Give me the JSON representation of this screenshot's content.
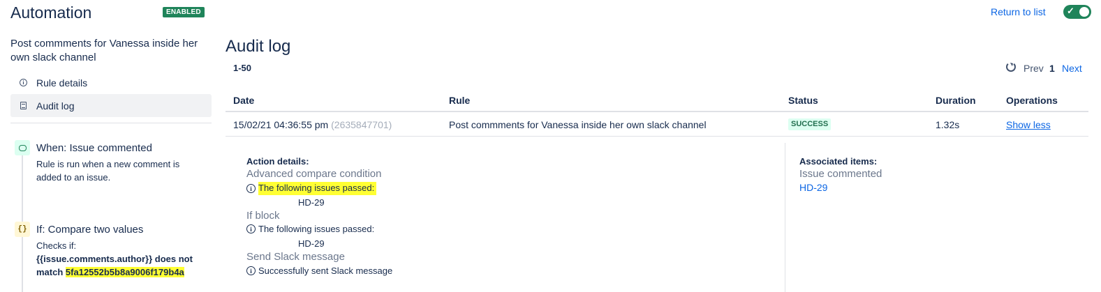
{
  "header": {
    "title": "Automation",
    "enabled_badge": "ENABLED",
    "return_link": "Return to list",
    "toggle_state": "on"
  },
  "sidebar": {
    "rule_name": "Post commments for Vanessa inside her own slack channel",
    "nav": [
      {
        "label": "Rule details",
        "icon": "info-icon"
      },
      {
        "label": "Audit log",
        "icon": "document-icon",
        "active": true
      }
    ],
    "components": [
      {
        "icon": "comment-icon",
        "title": "When: Issue commented",
        "description": "Rule is run when a new comment is added to an issue."
      },
      {
        "icon": "braces-icon",
        "icon_glyph": "{}",
        "title": "If: Compare two values",
        "checks_label": "Checks if:",
        "expression": "{{issue.comments.author}} does not match",
        "value": "5fa12552b5b8a9006f179b4a"
      }
    ]
  },
  "main": {
    "title": "Audit log",
    "range": "1-50",
    "pagination": {
      "prev": "Prev",
      "page": "1",
      "next": "Next"
    },
    "columns": [
      "Date",
      "Rule",
      "Status",
      "Duration",
      "Operations"
    ],
    "rows": [
      {
        "date": "15/02/21 04:36:55 pm",
        "execution_id": "(2635847701)",
        "rule": "Post commments for Vanessa inside her own slack channel",
        "status": "SUCCESS",
        "duration": "1.32s",
        "operation": "Show less"
      }
    ],
    "details": {
      "action_heading": "Action details:",
      "actions": [
        {
          "name": "Advanced compare condition",
          "message": "The following issues passed:",
          "issue": "HD-29"
        },
        {
          "name": "If block",
          "message": "The following issues passed:",
          "issue": "HD-29"
        },
        {
          "name": "Send Slack message",
          "message": "Successfully sent Slack message"
        }
      ],
      "associated_heading": "Associated items:",
      "associated": {
        "name": "Issue commented",
        "issue": "HD-29"
      }
    }
  },
  "colors": {
    "accent_green": "#1f845a",
    "link_blue": "#0c66e4",
    "highlight": "#ffff33",
    "text": "#172b4d"
  }
}
